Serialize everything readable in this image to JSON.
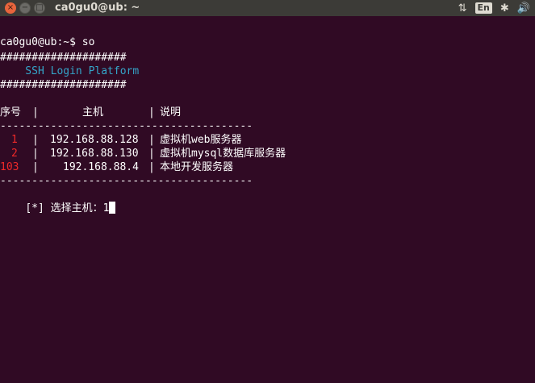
{
  "window": {
    "title": "ca0gu0@ub: ~",
    "close_glyph": "×",
    "min_glyph": "−",
    "max_glyph": "□"
  },
  "indicators": {
    "network_icon": "⇅",
    "lang": "En",
    "bluetooth_icon": "✱",
    "volume_icon": "🔊"
  },
  "terminal": {
    "prompt_line": "ca0gu0@ub:~$ so",
    "banner_border_top": "####################",
    "banner_title": "    SSH Login Platform",
    "banner_border_bottom": "####################",
    "table_header": {
      "col1": "序号",
      "sep1": "|",
      "col2": "主机",
      "sep2": "|",
      "col3": "说明"
    },
    "rule": "----------------------------------------",
    "rows": [
      {
        "num": "1",
        "host": "192.168.88.128",
        "desc": "虚拟机web服务器"
      },
      {
        "num": "2",
        "host": "192.168.88.130",
        "desc": "虚拟机mysql数据库服务器"
      },
      {
        "num": "103",
        "host": "192.168.88.4",
        "desc": "本地开发服务器"
      }
    ],
    "rule_bottom": "----------------------------------------",
    "input_prompt": "[*] 选择主机：",
    "input_value": "1"
  }
}
